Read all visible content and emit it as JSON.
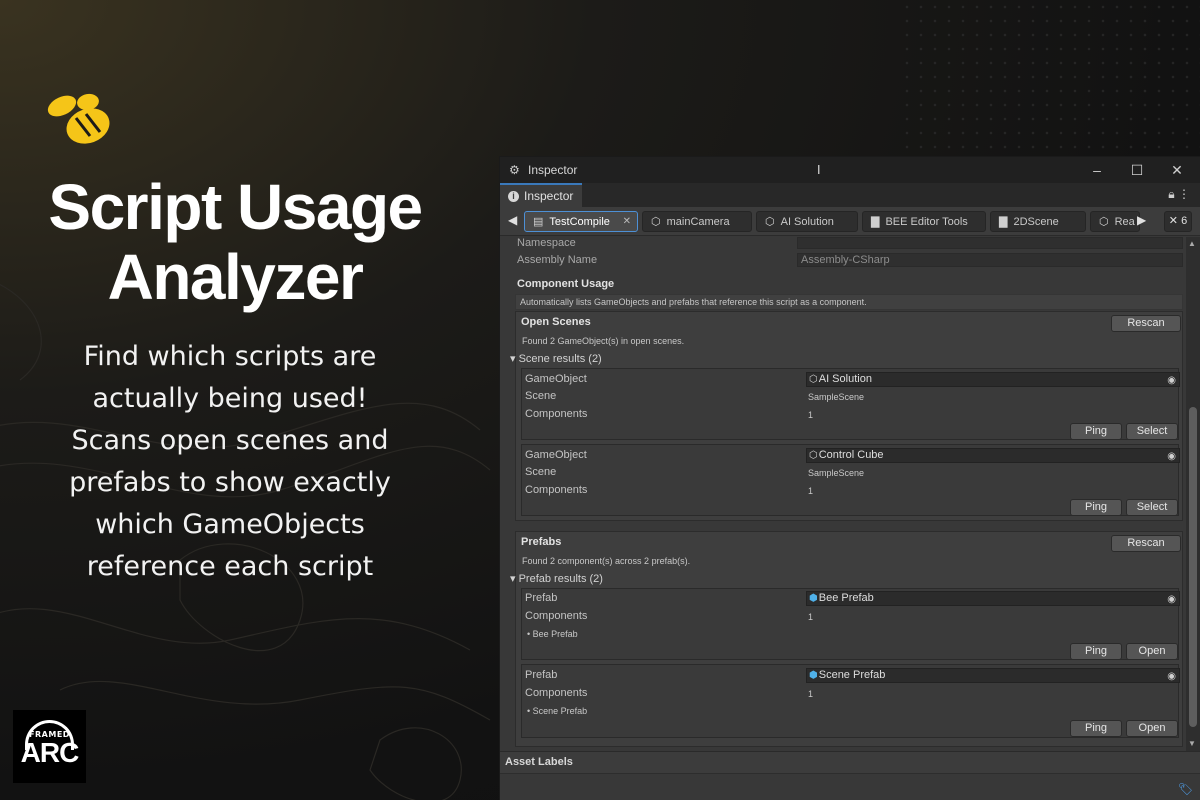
{
  "promo": {
    "title_line1": "Script Usage",
    "title_line2": "Analyzer",
    "desc_lines": [
      "Find which scripts are",
      "actually being used!",
      "Scans open scenes and",
      "prefabs to show exactly",
      "which GameObjects",
      "reference each script"
    ],
    "logo_icon": "bee-logo-icon",
    "brand_small": "FRAMED",
    "brand_big": "ARC",
    "accent_color": "#f5c518"
  },
  "window": {
    "title": "Inspector",
    "tab_label": "Inspector",
    "object_tabs": [
      {
        "label": "TestCompile",
        "icon": "script-icon",
        "active": true
      },
      {
        "label": "mainCamera",
        "icon": "cube-icon",
        "active": false
      },
      {
        "label": "AI Solution",
        "icon": "cube-icon",
        "active": false
      },
      {
        "label": "BEE Editor Tools",
        "icon": "folder-icon",
        "active": false
      },
      {
        "label": "2DScene",
        "icon": "folder-icon",
        "active": false
      },
      {
        "label": "Rea",
        "icon": "cube-icon",
        "active": false
      }
    ],
    "tab_count": "✕ 6"
  },
  "script_info": {
    "namespace_label": "Namespace",
    "namespace_value": "",
    "assembly_label": "Assembly Name",
    "assembly_value": "Assembly-CSharp"
  },
  "component_usage": {
    "heading": "Component Usage",
    "help": "Automatically lists GameObjects and prefabs that reference this script as a component.",
    "open_scenes": {
      "heading": "Open Scenes",
      "rescan": "Rescan",
      "status": "Found 2 GameObject(s) in open scenes.",
      "foldout": "Scene results (2)",
      "results": [
        {
          "gameobject_label": "GameObject",
          "gameobject": "AI Solution",
          "scene_label": "Scene",
          "scene": "SampleScene",
          "components_label": "Components",
          "components": "1",
          "ping": "Ping",
          "select": "Select"
        },
        {
          "gameobject_label": "GameObject",
          "gameobject": "Control Cube",
          "scene_label": "Scene",
          "scene": "SampleScene",
          "components_label": "Components",
          "components": "1",
          "ping": "Ping",
          "select": "Select"
        }
      ]
    },
    "prefabs": {
      "heading": "Prefabs",
      "rescan": "Rescan",
      "status": "Found 2 component(s) across 2 prefab(s).",
      "foldout": "Prefab results (2)",
      "results": [
        {
          "prefab_label": "Prefab",
          "prefab": "Bee Prefab",
          "components_label": "Components",
          "components": "1",
          "bullet": "• Bee Prefab",
          "ping": "Ping",
          "open": "Open"
        },
        {
          "prefab_label": "Prefab",
          "prefab": "Scene Prefab",
          "components_label": "Components",
          "components": "1",
          "bullet": "• Scene Prefab",
          "ping": "Ping",
          "open": "Open"
        }
      ]
    }
  },
  "footer": {
    "asset_labels": "Asset Labels"
  }
}
